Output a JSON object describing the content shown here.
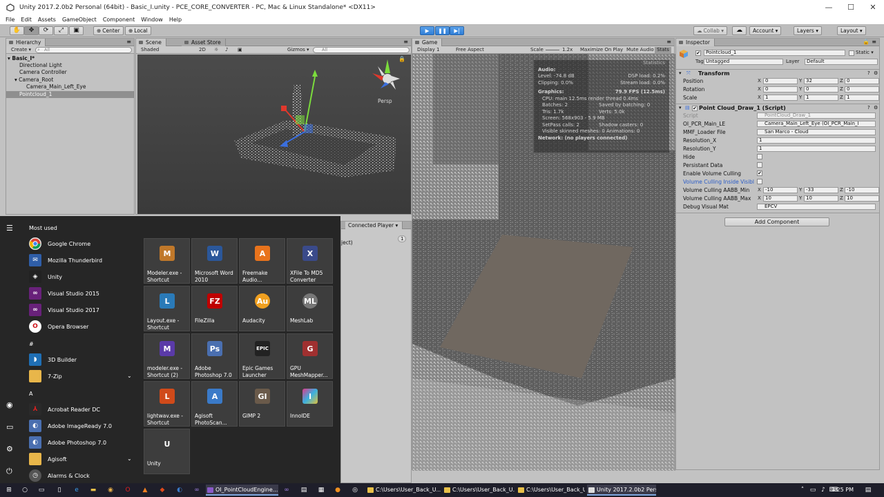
{
  "window": {
    "title": "Unity 2017.2.0b2 Personal (64bit) - Basic_I.unity - PCE_CORE_CONVERTER - PC, Mac & Linux Standalone* <DX11>"
  },
  "menu": [
    "File",
    "Edit",
    "Assets",
    "GameObject",
    "Component",
    "Window",
    "Help"
  ],
  "toolbar": {
    "pivot": "Center",
    "space": "Local",
    "collab": "Collab ▾",
    "account": "Account ▾",
    "layers": "Layers ▾",
    "layout": "Layout ▾"
  },
  "hierarchy": {
    "tab": "Hierarchy",
    "create": "Create ▾",
    "search_placeholder": "All",
    "items": [
      {
        "label": "▾ Basic_I*"
      },
      {
        "label": "Directional Light"
      },
      {
        "label": "Camera Controller"
      },
      {
        "label": "▾ Camera_Root"
      },
      {
        "label": "Camera_Main_Left_Eye"
      },
      {
        "label": "Pointcloud_1"
      }
    ]
  },
  "scene": {
    "tab": "Scene",
    "tab2": "Asset Store",
    "shading": "Shaded",
    "mode2d": "2D",
    "gizmos": "Gizmos ▾",
    "search_placeholder": "All",
    "persp": "Persp"
  },
  "game": {
    "tab": "Game",
    "display": "Display 1",
    "aspect": "Free Aspect",
    "scale": "Scale",
    "scale_value": "1.2x",
    "max_on_play": "Maximize On Play",
    "mute": "Mute Audio",
    "stats": "Stats",
    "statistics": {
      "title": "Statistics",
      "audio_head": "Audio:",
      "level": "Level: -74.8 dB",
      "clipping": "Clipping: 0.0%",
      "dsp": "DSP load: 0.2%",
      "stream": "Stream load: 0.0%",
      "graphics_head": "Graphics:",
      "fps": "79.9 FPS (12.5ms)",
      "cpu": "CPU: main 12.5ms  render thread 0.4ms",
      "batches": "Batches: 2",
      "saved": "Saved by batching: 0",
      "tris": "Tris: 1.7k",
      "verts": "Verts: 5.0k",
      "screen": "Screen: 568x903 - 5.9 MB",
      "setpass": "SetPass calls: 2",
      "shadow": "Shadow casters: 0",
      "skinned": "Visible skinned meshes: 0  Animations: 0",
      "network": "Network: (no players connected)"
    }
  },
  "console": {
    "tab": "Connected Player ▾",
    "line": "ject)",
    "count": "1"
  },
  "inspector": {
    "tab": "Inspector",
    "object_name": "Pointcloud_1",
    "static": "Static ▾",
    "tag_label": "Tag",
    "tag": "Untagged",
    "layer_label": "Layer",
    "layer": "Default",
    "transform": {
      "title": "Transform",
      "rows": [
        {
          "label": "Position",
          "x": "0",
          "y": "32",
          "z": "0"
        },
        {
          "label": "Rotation",
          "x": "0",
          "y": "0",
          "z": "0"
        },
        {
          "label": "Scale",
          "x": "1",
          "y": "1",
          "z": "1"
        }
      ]
    },
    "script": {
      "title": "Point Cloud_Draw_1 (Script)",
      "script_label": "Script",
      "script_value": "PointCloud_Draw_1",
      "oi_label": "OI_PCR_Main_LE",
      "oi_value": "Camera_Main_Left_Eye (OI_PCR_Main_I",
      "mmf_label": "MMF_Loader File",
      "mmf_value": "San Marco - Cloud",
      "resx_label": "Resolution_X",
      "resx": "1",
      "resy_label": "Resolution_Y",
      "resy": "1",
      "hide_label": "Hide",
      "persist_label": "Persistant Data",
      "cull_label": "Enable Volume Culling",
      "cull_inside_label": "Volume Culling Inside Visibl",
      "aabbmin_label": "Volume Culling AABB_Min",
      "min_x": "-10",
      "min_y": "-33",
      "min_z": "-10",
      "aabbmax_label": "Volume Culling AABB_Max",
      "max_x": "10",
      "max_y": "10",
      "max_z": "10",
      "debug_label": "Debug Visual Mat",
      "debug_value": "EPCV"
    },
    "add_component": "Add Component"
  },
  "startmenu": {
    "most_used": "Most used",
    "most_used_items": [
      "Google Chrome",
      "Mozilla Thunderbird",
      "Unity",
      "Visual Studio 2015",
      "Visual Studio 2017",
      "Opera Browser"
    ],
    "hash_head": "#",
    "hash_items": [
      "3D Builder",
      "7-Zip"
    ],
    "a_head": "A",
    "a_items": [
      "Acrobat Reader DC",
      "Adobe ImageReady 7.0",
      "Adobe Photoshop 7.0",
      "Agisoft",
      "Alarms & Clock"
    ],
    "tiles": [
      "Modeler.exe - Shortcut",
      "Microsoft Word 2010",
      "Freemake Audio...",
      "XFile To MD5 Converter",
      "Layout.exe - Shortcut",
      "FileZilla",
      "Audacity",
      "MeshLab",
      "modeler.exe - Shortcut (2)",
      "Adobe Photoshop 7.0",
      "Epic Games Launcher",
      "GPU MeshMapper...",
      "lightwav.exe - Shortcut",
      "Agisoft PhotoScan...",
      "GIMP 2",
      "InnoIDE",
      "Unity"
    ],
    "tile_icons": [
      "M",
      "W",
      "A",
      "X",
      "L",
      "FZ",
      "Au",
      "ML",
      "M",
      "Ps",
      "EPIC",
      "G",
      "L",
      "A",
      "GI",
      "I",
      "U"
    ]
  },
  "taskbar": {
    "tasks": [
      "OI_PointCloudEngine...",
      "C:\\Users\\User_Back_U...",
      "C:\\Users\\User_Back_U...",
      "C:\\Users\\User_Back_U...",
      "Unity 2017.2.0b2 Pers..."
    ],
    "time": "3:25 PM"
  }
}
